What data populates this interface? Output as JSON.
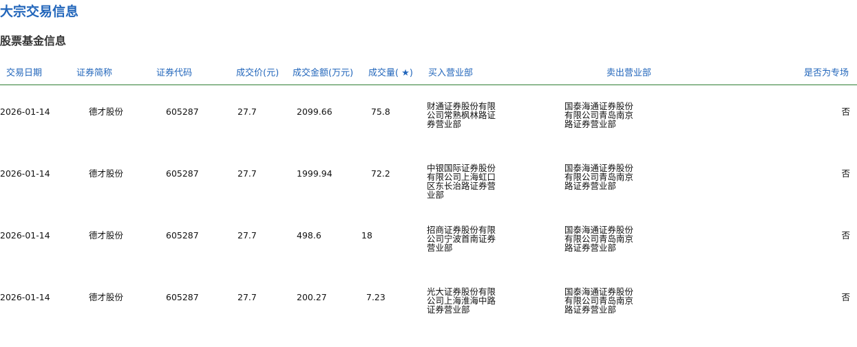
{
  "page": {
    "title": "大宗交易信息",
    "section_title": "股票基金信息"
  },
  "table": {
    "headers": {
      "date": "交易日期",
      "name": "证券简称",
      "code": "证券代码",
      "price": "成交价(元)",
      "amount": "成交金额(万元)",
      "volume": "成交量( ★)",
      "buyer": "买入营业部",
      "seller": "卖出营业部",
      "special": "是否为专场"
    },
    "rows": [
      {
        "date": "2026-01-14",
        "name": "德才股份",
        "code": "605287",
        "price": "27.7",
        "amount": "2099.66",
        "volume": "75.8",
        "buyer": "财通证券股份有限公司常熟枫林路证券营业部",
        "seller": "国泰海通证券股份有限公司青岛南京路证券营业部",
        "special": "否"
      },
      {
        "date": "2026-01-14",
        "name": "德才股份",
        "code": "605287",
        "price": "27.7",
        "amount": "1999.94",
        "volume": "72.2",
        "buyer": "中银国际证券股份有限公司上海虹口区东长治路证券营业部",
        "seller": "国泰海通证券股份有限公司青岛南京路证券营业部",
        "special": "否"
      },
      {
        "date": "2026-01-14",
        "name": "德才股份",
        "code": "605287",
        "price": "27.7",
        "amount": "498.6",
        "volume": "18",
        "buyer": "招商证券股份有限公司宁波首南证券营业部",
        "seller": "国泰海通证券股份有限公司青岛南京路证券营业部",
        "special": "否"
      },
      {
        "date": "2026-01-14",
        "name": "德才股份",
        "code": "605287",
        "price": "27.7",
        "amount": "200.27",
        "volume": "7.23",
        "buyer": "光大证券股份有限公司上海淮海中路证券营业部",
        "seller": "国泰海通证券股份有限公司青岛南京路证券营业部",
        "special": "否"
      }
    ]
  }
}
